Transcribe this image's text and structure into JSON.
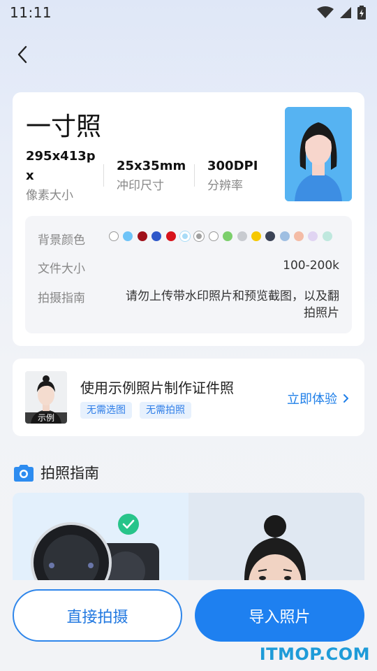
{
  "status_bar": {
    "time": "11:11"
  },
  "spec": {
    "title": "一寸照",
    "stats": [
      {
        "value": "295x413px",
        "label": "像素大小"
      },
      {
        "value": "25x35mm",
        "label": "冲印尺寸"
      },
      {
        "value": "300DPI",
        "label": "分辨率"
      }
    ],
    "details": {
      "bg_label": "背景颜色",
      "bg_colors": [
        "#ffffff",
        "#6ec3f7",
        "#a0101a",
        "#2f58c9",
        "#d8141c",
        "#a9dcf7",
        "#a0a0a0",
        "#ffffff",
        "#7ccf6c",
        "#c8cbd0",
        "#f6c800",
        "#3b4356",
        "#9fbfe2",
        "#f4bca6",
        "#e0d4f2",
        "#bfe8de"
      ],
      "size_label": "文件大小",
      "size_value": "100-200k",
      "guide_label": "拍摄指南",
      "guide_value": "请勿上传带水印照片和预览截图，以及翻拍照片"
    }
  },
  "example": {
    "tag": "示例",
    "title": "使用示例照片制作证件照",
    "chips": [
      "无需选图",
      "无需拍照"
    ],
    "link": "立即体验"
  },
  "guide": {
    "title": "拍照指南"
  },
  "actions": {
    "shoot": "直接拍摄",
    "import": "导入照片"
  },
  "watermark": "ITMOP.COM"
}
